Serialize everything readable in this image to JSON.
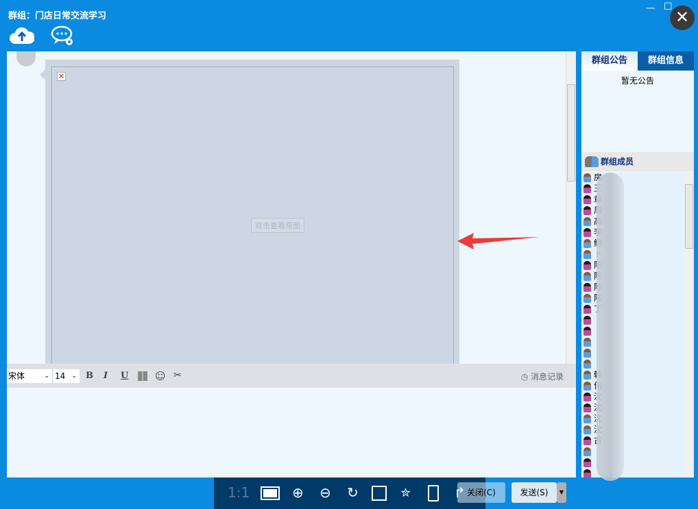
{
  "window": {
    "title": "群组：门店日常交流学习",
    "minimize": "—",
    "maximize": "☐",
    "close": "✕"
  },
  "toolbar": {
    "upload_icon": "cloud-upload",
    "settings_icon": "chat-settings"
  },
  "chat": {
    "broken_image": "✕",
    "view_original": "双击查看原图"
  },
  "format": {
    "font": "宋体",
    "size": "14",
    "bold": "B",
    "italic": "I",
    "underline": "U",
    "history": "消息记录"
  },
  "right": {
    "tab_notice": "群组公告",
    "tab_info": "群组信息",
    "notice_text": "暂无公告",
    "members_title": "群组成员",
    "members": [
      {
        "name": "房",
        "g": "male"
      },
      {
        "name": "王",
        "g": "female"
      },
      {
        "name": "章",
        "g": "female"
      },
      {
        "name": "周",
        "g": "female"
      },
      {
        "name": "高",
        "g": "male"
      },
      {
        "name": "李",
        "g": "female"
      },
      {
        "name": "鲍",
        "g": "male"
      },
      {
        "name": "卜",
        "g": "male"
      },
      {
        "name": "陈",
        "g": "female"
      },
      {
        "name": "陈",
        "g": "male"
      },
      {
        "name": "陈",
        "g": "female"
      },
      {
        "name": "陈",
        "g": "male"
      },
      {
        "name": "丁",
        "g": "female"
      },
      {
        "name": "",
        "g": "female"
      },
      {
        "name": "",
        "g": "female"
      },
      {
        "name": "",
        "g": "male"
      },
      {
        "name": "",
        "g": "male"
      },
      {
        "name": "",
        "g": "male"
      },
      {
        "name": "韩",
        "g": "male"
      },
      {
        "name": "何",
        "g": "male"
      },
      {
        "name": "沈",
        "g": "female"
      },
      {
        "name": "沈",
        "g": "female"
      },
      {
        "name": "沈",
        "g": "male"
      },
      {
        "name": "沈",
        "g": "male"
      },
      {
        "name": "古",
        "g": "female"
      },
      {
        "name": "",
        "g": "male"
      },
      {
        "name": "",
        "g": "female"
      },
      {
        "name": "",
        "g": "female"
      }
    ]
  },
  "viewer": {
    "actual_size": "1:1"
  },
  "buttons": {
    "close": "关闭(C)",
    "send": "发送(S)"
  }
}
